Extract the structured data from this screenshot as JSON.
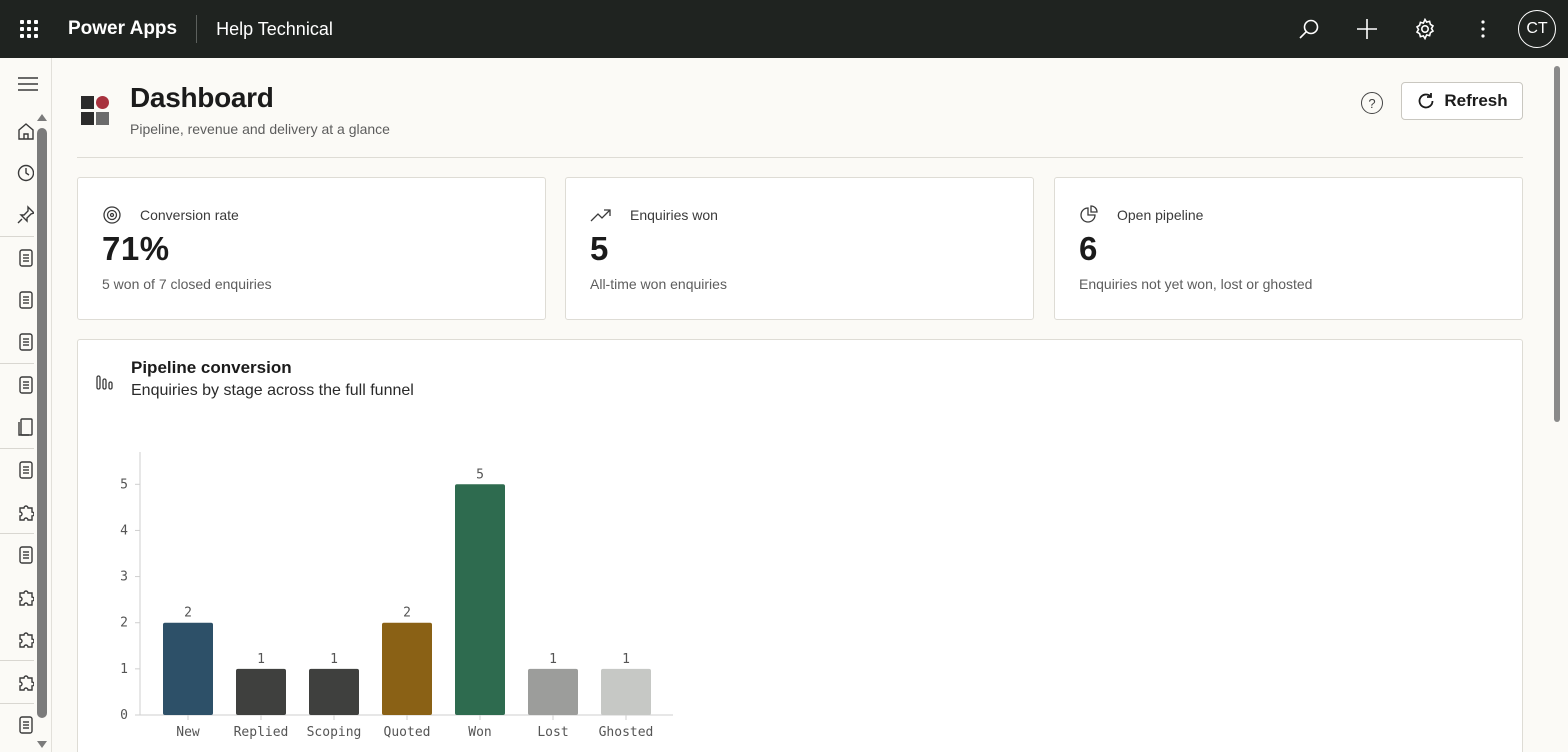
{
  "topbar": {
    "app_name": "Power Apps",
    "environment": "Help Technical",
    "avatar_initials": "CT"
  },
  "header": {
    "title": "Dashboard",
    "subtitle": "Pipeline, revenue and delivery at a glance",
    "help_label": "?",
    "refresh_label": "Refresh"
  },
  "cards": [
    {
      "label": "Conversion rate",
      "value": "71%",
      "note": "5 won of 7 closed enquiries",
      "icon": "target-icon"
    },
    {
      "label": "Enquiries won",
      "value": "5",
      "note": "All-time won enquiries",
      "icon": "trending-up-icon"
    },
    {
      "label": "Open pipeline",
      "value": "6",
      "note": "Enquiries not yet won, lost or ghosted",
      "icon": "pie-chart-icon"
    }
  ],
  "chart_panel": {
    "title": "Pipeline conversion",
    "subtitle": "Enquiries by stage across the full funnel"
  },
  "chart_data": {
    "type": "bar",
    "categories": [
      "New",
      "Replied",
      "Scoping",
      "Quoted",
      "Won",
      "Lost",
      "Ghosted"
    ],
    "values": [
      2,
      1,
      1,
      2,
      5,
      1,
      1
    ],
    "colors": [
      "#2d5068",
      "#3f403e",
      "#3f403e",
      "#8a6115",
      "#2e6b4f",
      "#9c9d9b",
      "#c6c8c5"
    ],
    "yticks": [
      0,
      1,
      2,
      3,
      4,
      5
    ],
    "ylim": [
      0,
      5.7
    ],
    "title": "",
    "xlabel": "",
    "ylabel": "",
    "grid": false
  },
  "colors": {
    "topbar_bg": "#1f2320",
    "logo_dark": "#2b2b2b",
    "logo_red": "#a8323e",
    "logo_gray": "#6b6b6b"
  }
}
